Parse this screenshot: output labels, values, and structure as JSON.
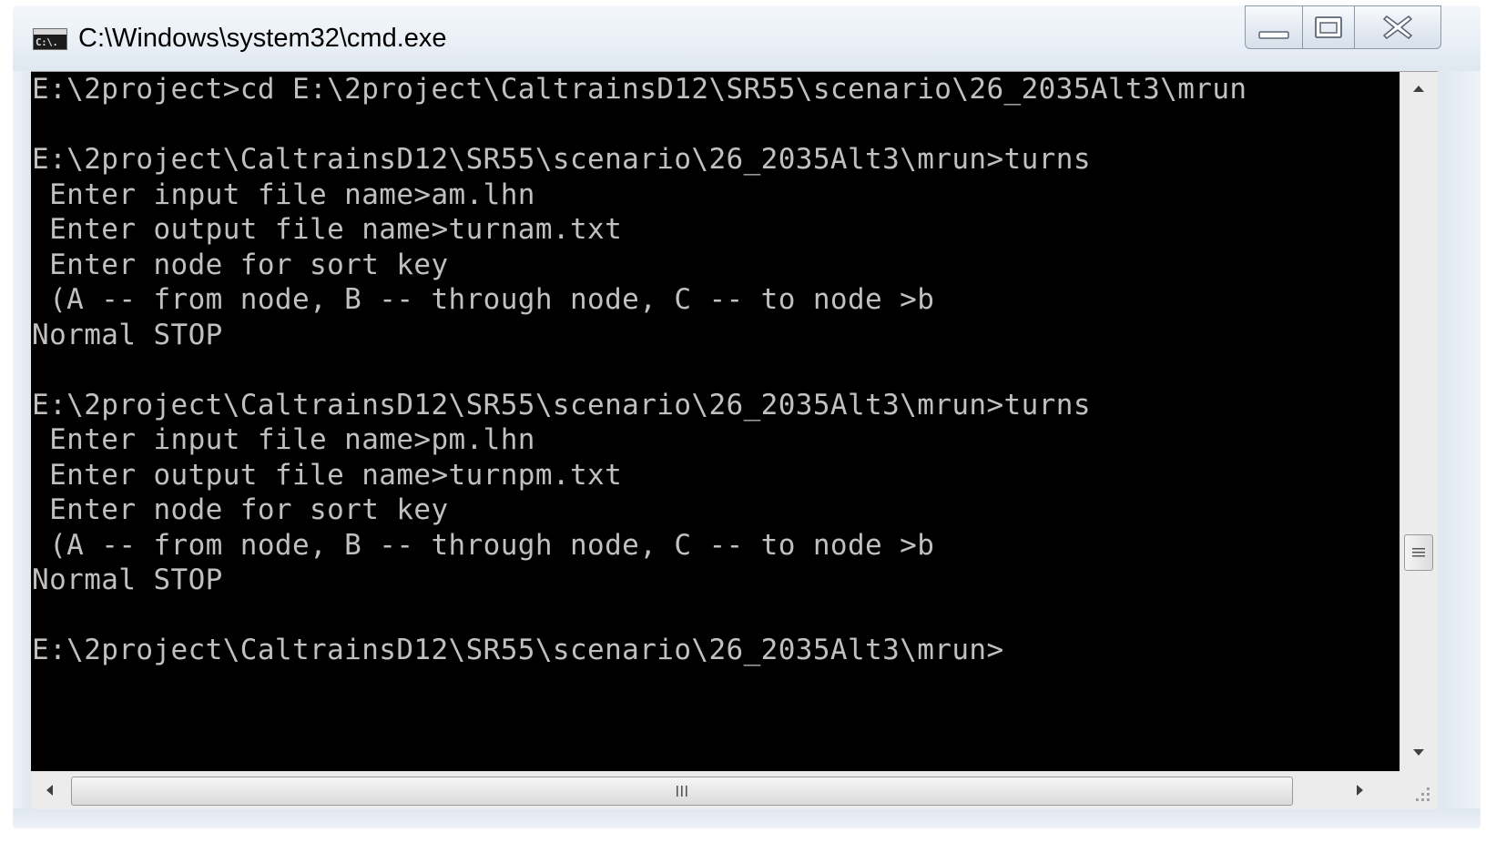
{
  "window": {
    "title": "C:\\Windows\\system32\\cmd.exe",
    "icon": "cmd-icon",
    "icon_text": "C:\\."
  },
  "caption_buttons": {
    "minimize_icon": "minimize-icon",
    "maximize_icon": "maximize-icon",
    "close_icon": "close-icon"
  },
  "console": {
    "background": "#000000",
    "foreground": "#c0c0c0",
    "lines": [
      "E:\\2project>cd E:\\2project\\CaltrainsD12\\SR55\\scenario\\26_2035Alt3\\mrun",
      "",
      "E:\\2project\\CaltrainsD12\\SR55\\scenario\\26_2035Alt3\\mrun>turns",
      " Enter input file name>am.lhn",
      " Enter output file name>turnam.txt",
      " Enter node for sort key",
      " (A -- from node, B -- through node, C -- to node >b",
      "Normal STOP",
      "",
      "E:\\2project\\CaltrainsD12\\SR55\\scenario\\26_2035Alt3\\mrun>turns",
      " Enter input file name>pm.lhn",
      " Enter output file name>turnpm.txt",
      " Enter node for sort key",
      " (A -- from node, B -- through node, C -- to node >b",
      "Normal STOP",
      "",
      "E:\\2project\\CaltrainsD12\\SR55\\scenario\\26_2035Alt3\\mrun>"
    ]
  },
  "scrollbars": {
    "vertical": {
      "up_icon": "scroll-up-arrow-icon",
      "down_icon": "scroll-down-arrow-icon",
      "thumb_grip_icon": "grip-icon",
      "position": 0.72
    },
    "horizontal": {
      "left_icon": "scroll-left-arrow-icon",
      "right_icon": "scroll-right-arrow-icon",
      "thumb_grip_icon": "grip-icon"
    },
    "size_grip_icon": "size-grip-icon"
  }
}
